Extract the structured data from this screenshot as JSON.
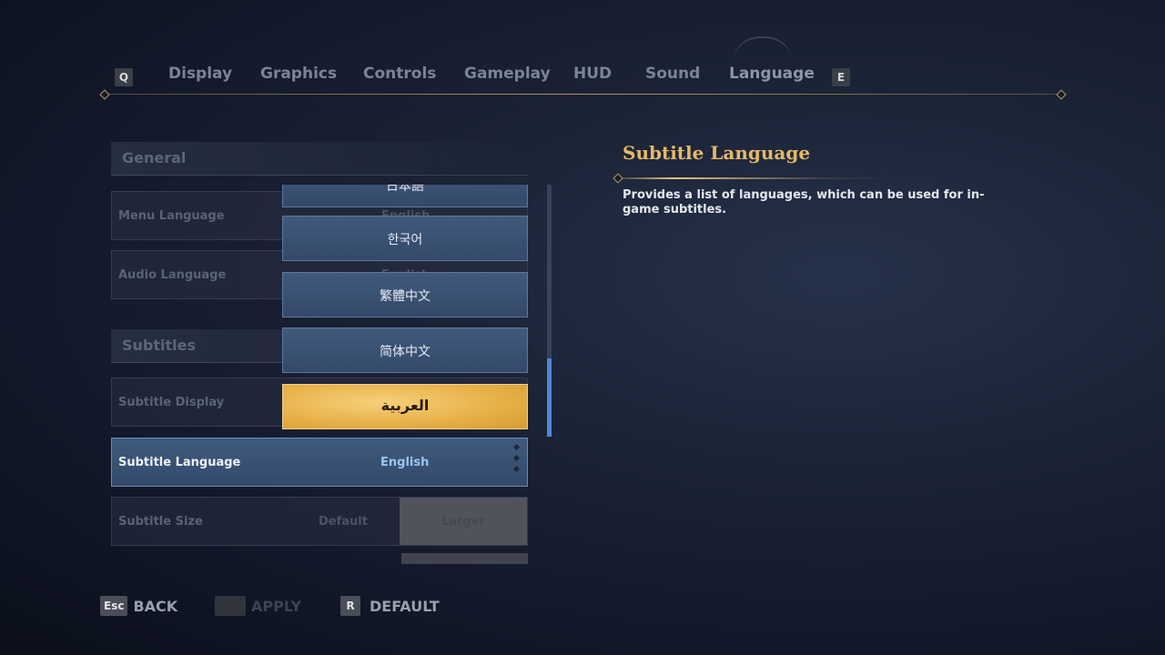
{
  "tabs": {
    "prev_key": "Q",
    "next_key": "E",
    "items": [
      {
        "label": "Display"
      },
      {
        "label": "Graphics"
      },
      {
        "label": "Controls"
      },
      {
        "label": "Gameplay"
      },
      {
        "label": "HUD"
      },
      {
        "label": "Sound"
      },
      {
        "label": "Language"
      }
    ]
  },
  "settings": {
    "general_header": "General",
    "menu_language": {
      "label": "Menu Language",
      "value": "English"
    },
    "audio_language": {
      "label": "Audio Language",
      "value": "English"
    },
    "subtitles_header": "Subtitles",
    "subtitle_display": {
      "label": "Subtitle Display"
    },
    "subtitle_language": {
      "label": "Subtitle Language",
      "value": "English"
    },
    "subtitle_size": {
      "label": "Subtitle Size",
      "option_default": "Default",
      "option_larger": "Larger"
    }
  },
  "dropdown": {
    "items": [
      "日本語",
      "한국어",
      "繁體中文",
      "简体中文",
      "العربية"
    ],
    "highlighted": "العربية"
  },
  "description": {
    "title": "Subtitle Language",
    "text": "Provides a list of languages, which can be used for in-game subtitles."
  },
  "footer": {
    "back_key": "Esc",
    "back_label": "BACK",
    "apply_label": "APPLY",
    "default_key": "R",
    "default_label": "DEFAULT"
  }
}
